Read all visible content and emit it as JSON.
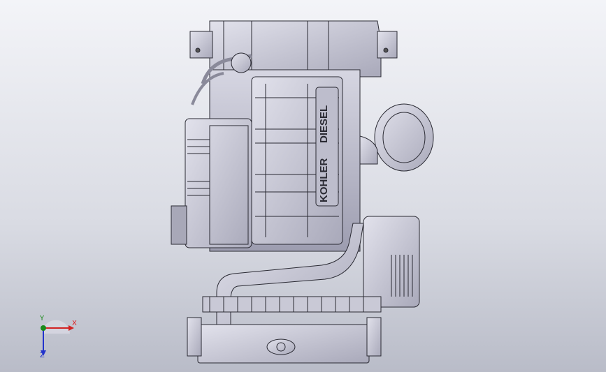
{
  "viewport": {
    "background_top": "#f3f4f8",
    "background_bottom": "#b9bcc8"
  },
  "model": {
    "brand_text": "KOHLER",
    "brand_text_2": "DIESEL",
    "line_color": "#2a2a33",
    "body_color": "#c8c8d6"
  },
  "triad": {
    "x_label": "X",
    "y_label": "Y",
    "z_label": "Z",
    "x_color": "#d22222",
    "y_color": "#1a8a1a",
    "z_color": "#2233cc"
  }
}
